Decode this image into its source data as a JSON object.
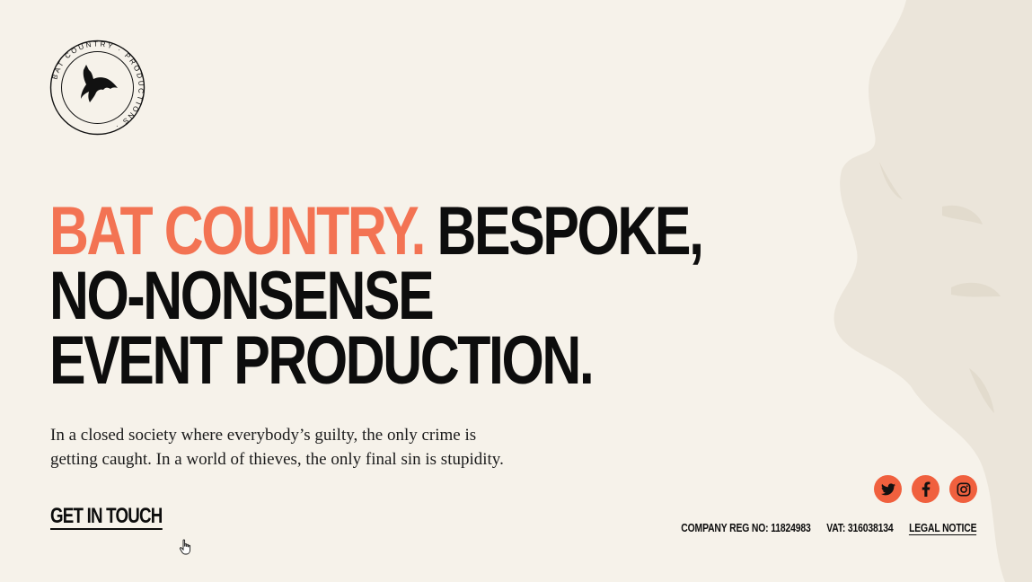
{
  "brand": {
    "logo_ring_text": "BAT COUNTRY · PRODUCTIONS ·"
  },
  "hero": {
    "headline_accent": "BAT COUNTRY.",
    "headline_line1_rest": " BESPOKE,",
    "headline_line2": "NO-NONSENSE",
    "headline_line3": "EVENT PRODUCTION.",
    "lede_line1": "In a closed society where everybody’s guilty, the only crime is",
    "lede_line2": "getting caught. In a world of thieves, the only final sin is stupidity.",
    "cta_label": "GET IN TOUCH"
  },
  "social": {
    "items": [
      {
        "name": "twitter",
        "icon": "twitter-icon"
      },
      {
        "name": "facebook",
        "icon": "facebook-icon"
      },
      {
        "name": "instagram",
        "icon": "instagram-icon"
      }
    ]
  },
  "footer": {
    "company_reg": "COMPANY REG NO: 11824983",
    "vat": "VAT: 316038134",
    "legal_notice": "LEGAL NOTICE"
  },
  "colors": {
    "background": "#f6f2ea",
    "accent": "#f37353",
    "social_bg": "#f0603e",
    "text": "#0d0d0d",
    "face_shape": "#ebe5da"
  }
}
